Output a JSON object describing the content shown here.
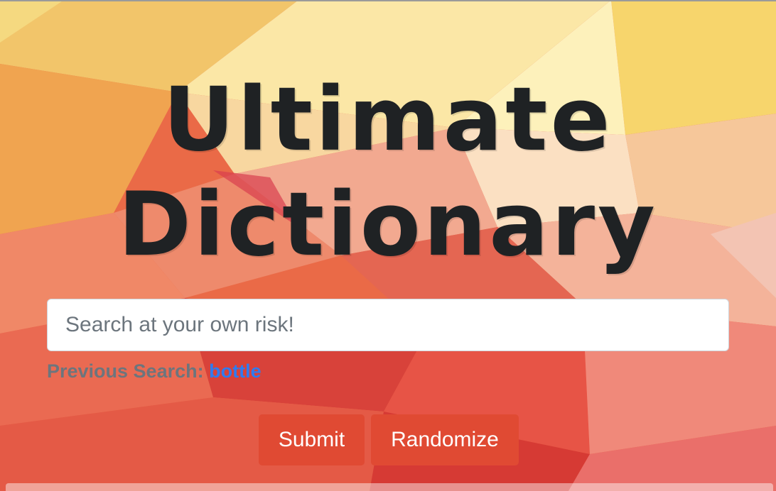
{
  "header": {
    "title_line1": "Ultimate",
    "title_line2": "Dictionary"
  },
  "search": {
    "placeholder": "Search at your own risk!",
    "value": ""
  },
  "previous_search": {
    "label": "Previous Search:",
    "term": "bottle"
  },
  "actions": {
    "submit_label": "Submit",
    "randomize_label": "Randomize"
  },
  "colors": {
    "title": "#1f2224",
    "button": "#e04a33",
    "link": "#2f7bf0",
    "muted_text": "#6c757d"
  }
}
